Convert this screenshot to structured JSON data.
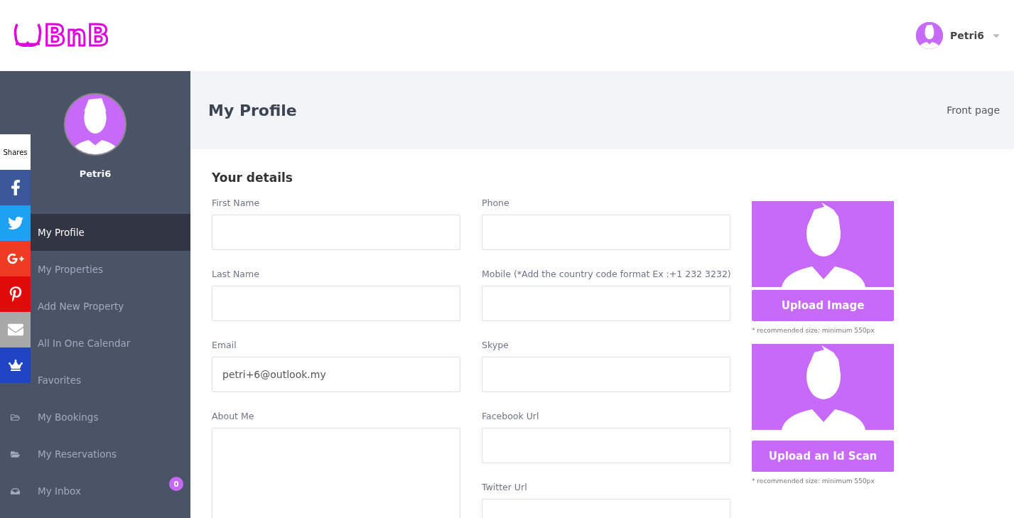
{
  "header": {
    "logo": "BnB",
    "user": {
      "name": "Petri6"
    }
  },
  "sidebar": {
    "user_name": "Petri6",
    "items": [
      {
        "label": "My Profile",
        "selected": true,
        "kind": "plain"
      },
      {
        "label": "My Properties",
        "selected": false,
        "kind": "plain"
      },
      {
        "label": "Add New Property",
        "selected": false,
        "kind": "plain"
      },
      {
        "label": "All In One Calendar",
        "selected": false,
        "kind": "plain"
      },
      {
        "label": "Favorites",
        "selected": false,
        "kind": "plain"
      },
      {
        "label": "My Bookings",
        "selected": false,
        "kind": "folder-outline"
      },
      {
        "label": "My Reservations",
        "selected": false,
        "kind": "folder"
      },
      {
        "label": "My Inbox",
        "selected": false,
        "kind": "inbox",
        "badge": "0"
      }
    ]
  },
  "share_bar": {
    "label": "Shares",
    "buttons": [
      {
        "kind": "facebook",
        "color": "#3b5998"
      },
      {
        "kind": "twitter",
        "color": "#1da1f2"
      },
      {
        "kind": "googleplus",
        "color": "#ef3b24"
      },
      {
        "kind": "pinterest",
        "color": "#e00b0b"
      },
      {
        "kind": "email",
        "color": "#a8a8a8"
      },
      {
        "kind": "crown",
        "color": "#1f44c4"
      }
    ]
  },
  "page": {
    "title": "My Profile",
    "breadcrumb": "Front page"
  },
  "form": {
    "title": "Your details",
    "column_1": [
      {
        "label": "First Name",
        "kind": "input"
      },
      {
        "label": "Last Name",
        "kind": "input"
      },
      {
        "label": "Email",
        "kind": "input",
        "value": "petri+6@outlook.my"
      },
      {
        "label": "About Me",
        "kind": "textarea"
      }
    ],
    "column_2": [
      {
        "label": "Phone",
        "kind": "input"
      },
      {
        "label": "Mobile (*Add the country code format Ex :+1 232 3232)",
        "kind": "input"
      },
      {
        "label": "Skype",
        "kind": "input"
      },
      {
        "label": "Facebook Url",
        "kind": "input"
      },
      {
        "label": "Twitter Url",
        "kind": "input"
      }
    ],
    "uploads": [
      {
        "button": "Upload Image",
        "note": "* recommended size: minimum 550px"
      },
      {
        "button": "Upload an Id Scan",
        "note": "* recommended size: minimum 550px"
      }
    ]
  }
}
